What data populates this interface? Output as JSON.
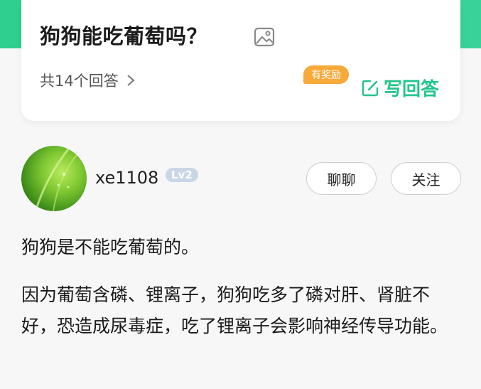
{
  "question": {
    "title": "狗狗能吃葡萄吗？",
    "answer_count": "共14个回答",
    "reward_badge": "有奖励",
    "write_answer": "写回答"
  },
  "answer": {
    "username": "xe1108",
    "level": "Lv2",
    "chat_label": "聊聊",
    "follow_label": "关注",
    "paragraphs": [
      "狗狗是不能吃葡萄的。",
      "因为葡萄含磷、锂离子，狗狗吃多了磷对肝、肾脏不好，恐造成尿毒症，吃了锂离子会影响神经传导功能。"
    ]
  },
  "colors": {
    "brand_green": "#23c48a",
    "reward_orange": "#f7a93a"
  },
  "icons": [
    "image-icon",
    "chevron-right-icon",
    "edit-icon"
  ]
}
